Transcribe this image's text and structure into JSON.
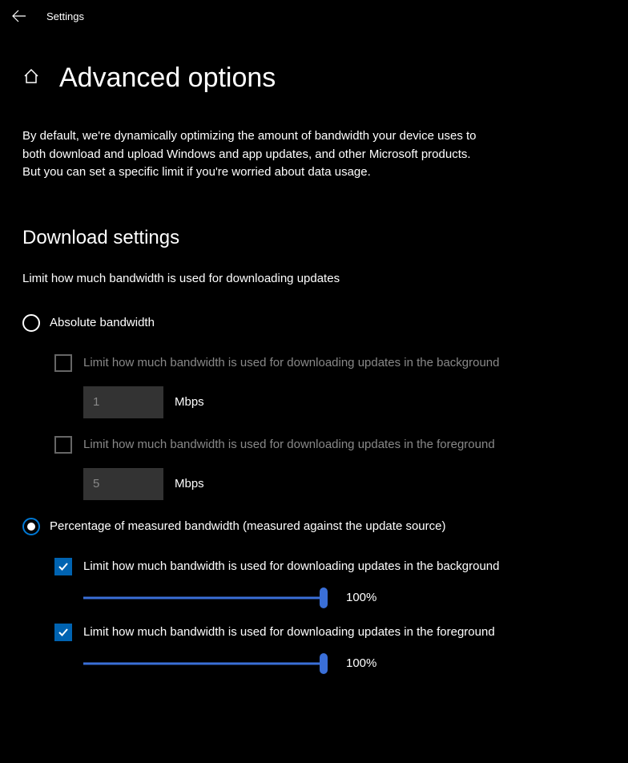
{
  "titlebar": {
    "app_name": "Settings"
  },
  "header": {
    "title": "Advanced options"
  },
  "intro": "By default, we're dynamically optimizing the amount of bandwidth your device uses to both download and upload Windows and app updates, and other Microsoft products. But you can set a specific limit if you're worried about data usage.",
  "download": {
    "section_title": "Download settings",
    "subtitle": "Limit how much bandwidth is used for downloading updates",
    "absolute": {
      "label": "Absolute bandwidth",
      "bg": {
        "label": "Limit how much bandwidth is used for downloading updates in the background",
        "value": "1",
        "unit": "Mbps"
      },
      "fg": {
        "label": "Limit how much bandwidth is used for downloading updates in the foreground",
        "value": "5",
        "unit": "Mbps"
      }
    },
    "percentage": {
      "label": "Percentage of measured bandwidth (measured against the update source)",
      "bg": {
        "label": "Limit how much bandwidth is used for downloading updates in the background",
        "value": "100%"
      },
      "fg": {
        "label": "Limit how much bandwidth is used for downloading updates in the foreground",
        "value": "100%"
      }
    }
  }
}
